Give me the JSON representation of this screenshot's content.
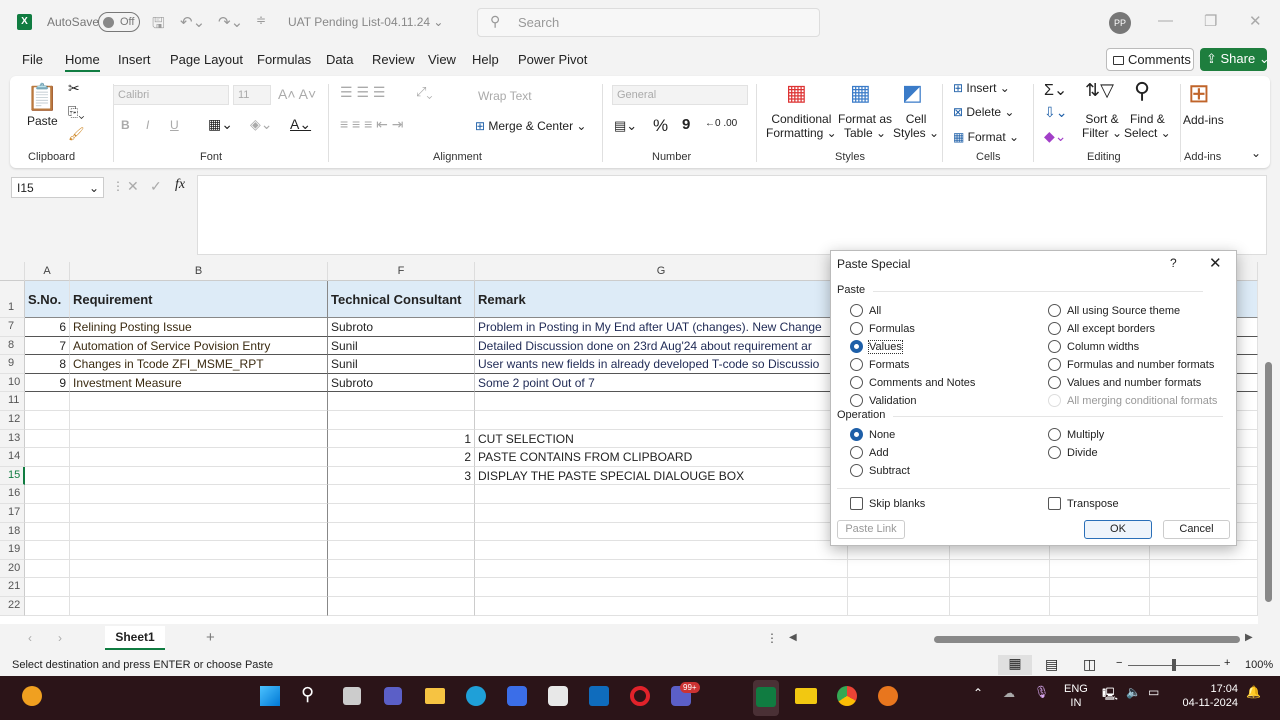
{
  "titlebar": {
    "autosave": "AutoSave",
    "autosave_state": "Off",
    "doc_title": "UAT Pending List-04.11.24 ⌄",
    "search_placeholder": "Search",
    "avatar": "PP",
    "logo": "X"
  },
  "tabs": [
    "File",
    "Home",
    "Insert",
    "Page Layout",
    "Formulas",
    "Data",
    "Review",
    "View",
    "Help",
    "Power Pivot"
  ],
  "header_buttons": {
    "comments": "Comments",
    "share": "Share"
  },
  "ribbon": {
    "clipboard": {
      "label": "Clipboard",
      "paste": "Paste"
    },
    "font": {
      "label": "Font",
      "font_name": "Calibri",
      "font_size": "11",
      "bold": "B",
      "italic": "I",
      "underline": "U"
    },
    "alignment": {
      "label": "Alignment",
      "wrap_text": "Wrap Text",
      "merge_center": "Merge & Center"
    },
    "number": {
      "label": "Number",
      "format": "General",
      "percent": "%",
      "comma": "9"
    },
    "styles": {
      "label": "Styles",
      "conditional": "Conditional",
      "conditional2": "Formatting ⌄",
      "format_table": "Format as",
      "format_table2": "Table ⌄",
      "cell_styles": "Cell",
      "cell_styles2": "Styles ⌄"
    },
    "cells": {
      "label": "Cells",
      "insert": "Insert ⌄",
      "delete": "Delete ⌄",
      "format": "Format ⌄"
    },
    "editing": {
      "label": "Editing",
      "sort": "Sort &",
      "sort2": "Filter ⌄",
      "find": "Find &",
      "find2": "Select ⌄"
    },
    "addins": {
      "label": "Add-ins",
      "addins": "Add-ins"
    }
  },
  "formula_bar": {
    "name_box": "I15",
    "fx": "fx",
    "value": ""
  },
  "columns": [
    {
      "id": "A"
    },
    {
      "id": "B"
    },
    {
      "id": "F"
    },
    {
      "id": "G"
    },
    {
      "id": ""
    },
    {
      "id": ""
    },
    {
      "id": ""
    },
    {
      "id": ""
    }
  ],
  "rows": [
    {
      "n": "1",
      "cells": [
        "S.No.",
        "Requirement",
        "Technical Consultant",
        "Remark"
      ]
    },
    {
      "n": "7",
      "cells": [
        "6",
        "Relining Posting Issue",
        "Subroto",
        "Problem in Posting in My End after UAT (changes). New Change"
      ]
    },
    {
      "n": "8",
      "cells": [
        "7",
        "Automation of Service Povision Entry",
        "Sunil",
        "Detailed Discussion done on 23rd Aug'24 about requirement ar"
      ]
    },
    {
      "n": "9",
      "cells": [
        "8",
        "Changes in Tcode ZFI_MSME_RPT",
        "Sunil",
        "User wants new fields in already developed T-code so Discussio"
      ]
    },
    {
      "n": "10",
      "cells": [
        "9",
        "Investment Measure",
        "Subroto",
        "Some 2 point  Out of 7"
      ]
    },
    {
      "n": "11",
      "cells": [
        "",
        "",
        "",
        ""
      ]
    },
    {
      "n": "12",
      "cells": [
        "",
        "",
        "",
        ""
      ]
    },
    {
      "n": "13",
      "cells": [
        "",
        "",
        "1",
        "CUT SELECTION"
      ]
    },
    {
      "n": "14",
      "cells": [
        "",
        "",
        "2",
        "PASTE CONTAINS FROM CLIPBOARD"
      ]
    },
    {
      "n": "15",
      "cells": [
        "",
        "",
        "3",
        "DISPLAY THE PASTE SPECIAL DIALOUGE BOX"
      ]
    },
    {
      "n": "16",
      "cells": [
        "",
        "",
        "",
        ""
      ]
    },
    {
      "n": "17",
      "cells": [
        "",
        "",
        "",
        ""
      ]
    },
    {
      "n": "18",
      "cells": [
        "",
        "",
        "",
        ""
      ]
    },
    {
      "n": "19",
      "cells": [
        "",
        "",
        "",
        ""
      ]
    },
    {
      "n": "20",
      "cells": [
        "",
        "",
        "",
        ""
      ]
    },
    {
      "n": "21",
      "cells": [
        "",
        "",
        "",
        ""
      ]
    },
    {
      "n": "22",
      "cells": [
        "",
        "",
        "",
        ""
      ]
    }
  ],
  "sheet_tab": "Sheet1",
  "status": {
    "message": "Select destination and press ENTER or choose Paste",
    "zoom": "100%"
  },
  "taskbar": {
    "lang": "ENG",
    "region": "IN",
    "time": "17:04",
    "date": "04-11-2024",
    "badge": "99+"
  },
  "dialog": {
    "title": "Paste Special",
    "help": "?",
    "paste_section": "Paste",
    "operation_section": "Operation",
    "paste_left": [
      {
        "label": "All",
        "on": false
      },
      {
        "label": "Formulas",
        "on": false
      },
      {
        "label": "Values",
        "on": true
      },
      {
        "label": "Formats",
        "on": false
      },
      {
        "label": "Comments and Notes",
        "on": false
      },
      {
        "label": "Validation",
        "on": false
      }
    ],
    "paste_right": [
      {
        "label": "All using Source theme",
        "dis": false
      },
      {
        "label": "All except borders",
        "dis": false
      },
      {
        "label": "Column widths",
        "dis": false
      },
      {
        "label": "Formulas and number formats",
        "dis": false
      },
      {
        "label": "Values and number formats",
        "dis": false
      },
      {
        "label": "All merging conditional formats",
        "dis": true
      }
    ],
    "op_left": [
      {
        "label": "None",
        "on": true
      },
      {
        "label": "Add",
        "on": false
      },
      {
        "label": "Subtract",
        "on": false
      }
    ],
    "op_right": [
      {
        "label": "Multiply"
      },
      {
        "label": "Divide"
      }
    ],
    "skip_blanks": "Skip blanks",
    "transpose": "Transpose",
    "paste_link": "Paste Link",
    "ok": "OK",
    "cancel": "Cancel"
  }
}
